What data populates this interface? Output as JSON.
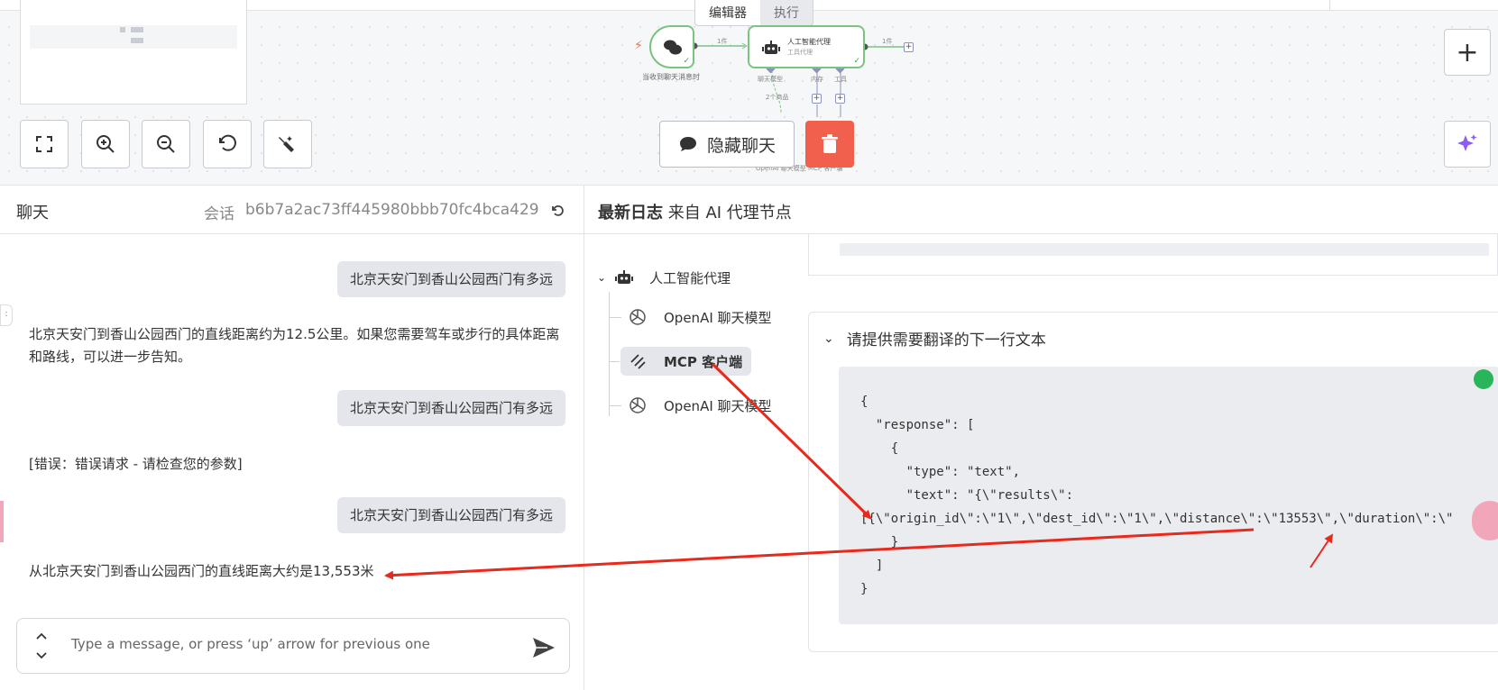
{
  "canvas": {
    "mode_tabs": [
      "编辑器",
      "执行"
    ],
    "trigger_label": "当收到聊天消息时",
    "agent_title": "人工智能代理",
    "agent_subtitle": "工具代理",
    "edge_label_in": "1件",
    "edge_label_out": "1件",
    "port_labels": [
      "聊天模型",
      "内存",
      "工具"
    ],
    "sub_edge_label": "2个商品",
    "sub_node_labels": "OpenAI 聊天模型   MCP 客户端",
    "hide_chat_label": "隐藏聊天",
    "toolbar_icons": [
      "fit-view-icon",
      "zoom-in-icon",
      "zoom-out-icon",
      "reset-zoom-icon",
      "tidy-up-icon"
    ]
  },
  "chat": {
    "title": "聊天",
    "session_label": "会话",
    "session_id": "b6b7a2ac73ff445980bbb70fc4bca429",
    "messages": [
      {
        "role": "user",
        "text": "北京天安门到香山公园西门有多远"
      },
      {
        "role": "bot",
        "text": "北京天安门到香山公园西门的直线距离约为12.5公里。如果您需要驾车或步行的具体距离和路线，可以进一步告知。"
      },
      {
        "role": "user",
        "text": "北京天安门到香山公园西门有多远"
      },
      {
        "role": "bot",
        "text": "[错误：错误请求 - 请检查您的参数]"
      },
      {
        "role": "user",
        "text": "北京天安门到香山公园西门有多远"
      },
      {
        "role": "bot",
        "text": "从北京天安门到香山公园西门的直线距离大约是13,553米"
      }
    ],
    "input_placeholder": "Type a message, or press ‘up’ arrow for previous one"
  },
  "logs": {
    "title_bold": "最新日志",
    "title_rest": " 来自 AI 代理节点",
    "tree": {
      "root": "人工智能代理",
      "children": [
        "OpenAI 聊天模型",
        "MCP 客户端",
        "OpenAI 聊天模型"
      ],
      "selected_index": 1
    },
    "detail_title": "请提供需要翻译的下一行文本",
    "code": "{\n  \"response\": [\n    {\n      \"type\": \"text\",\n      \"text\": \"{\\\"results\\\":\n[{\\\"origin_id\\\":\\\"1\\\",\\\"dest_id\\\":\\\"1\\\",\\\"distance\\\":\\\"13553\\\",\\\"duration\\\":\\\"\n    }\n  ]\n}"
  },
  "colors": {
    "accent_green": "#7bc47f",
    "delete_red": "#f0604d",
    "annotation_red": "#e8291c",
    "user_bubble": "#e4e6ec"
  }
}
